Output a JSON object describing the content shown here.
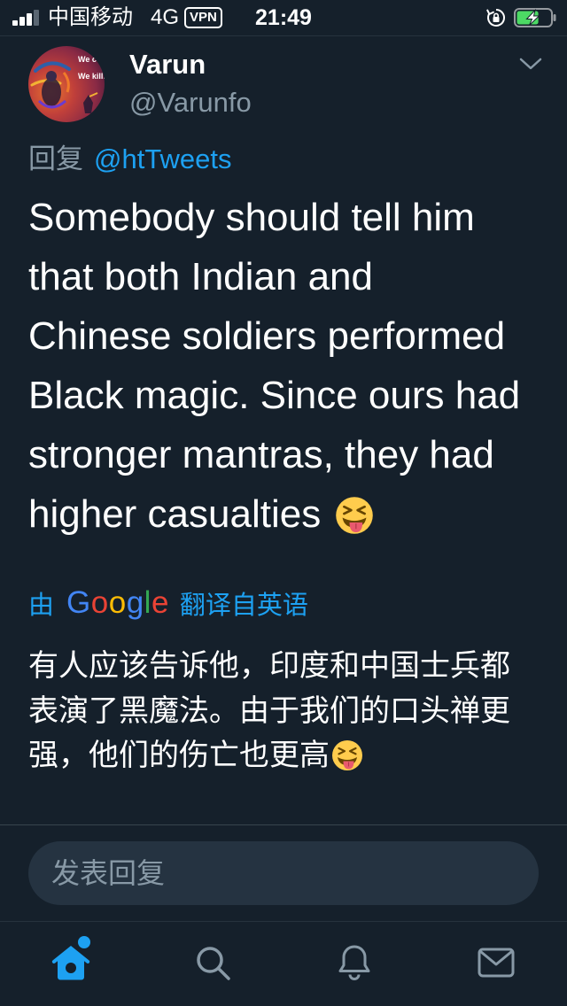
{
  "status_bar": {
    "carrier": "中国移动",
    "network": "4G",
    "vpn": "VPN",
    "time": "21:49",
    "signal": {
      "active_bars": 3,
      "total_bars": 4,
      "icon": "signal-icon"
    },
    "orientation_lock_icon": "orientation-lock-icon",
    "battery": {
      "level": 0.65,
      "charging": true,
      "icon": "battery-charging-icon",
      "fill_color": "#4cd964"
    }
  },
  "tweet": {
    "author": {
      "name": "Varun",
      "handle": "@Varunfo",
      "avatar_text": [
        "We con",
        "We kill."
      ]
    },
    "menu_icon": "chevron-down-icon",
    "reply_prefix": "回复",
    "reply_to": "@htTweets",
    "text_lines": [
      "Somebody should tell him",
      "that both Indian and",
      "Chinese soldiers performed",
      "Black magic. Since ours had",
      "stronger mantras, they had",
      "higher casualties"
    ],
    "trailing_emoji_icon": "squinting-face-with-tongue-icon"
  },
  "translation": {
    "prefix": "由",
    "logo_text": "Google",
    "logo_colors": [
      "#4285f4",
      "#ea4335",
      "#fbbc05",
      "#4285f4",
      "#34a853",
      "#ea4335"
    ],
    "suffix": "翻译自英语",
    "text_lines": [
      "有人应该告诉他，印度和中国士兵都",
      "表演了黑魔法。由于我们的口头禅更",
      "强，他们的伤亡也更高"
    ],
    "trailing_emoji_icon": "squinting-face-with-tongue-icon"
  },
  "composer": {
    "placeholder": "发表回复"
  },
  "tab_bar": {
    "items": [
      {
        "icon": "home-icon",
        "active": true,
        "notification_dot": true
      },
      {
        "icon": "search-icon",
        "active": false
      },
      {
        "icon": "bell-icon",
        "active": false
      },
      {
        "icon": "mail-icon",
        "active": false
      }
    ]
  },
  "colors": {
    "background": "#15202b",
    "primary_text": "#ffffff",
    "secondary_text": "#8899a6",
    "accent": "#1da1f2",
    "composer_background": "#253341",
    "divider": "#38444d"
  }
}
